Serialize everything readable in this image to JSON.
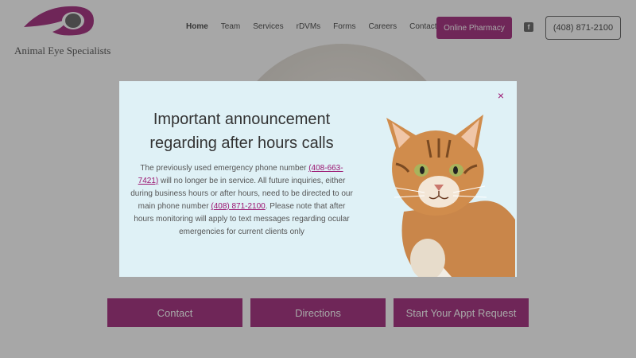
{
  "site": {
    "logo_text": "Animal Eye Specialists"
  },
  "nav": {
    "items": [
      {
        "label": "Home",
        "name": "nav-home"
      },
      {
        "label": "Team",
        "name": "nav-team"
      },
      {
        "label": "Services",
        "name": "nav-services"
      },
      {
        "label": "rDVMs",
        "name": "nav-rdvms"
      },
      {
        "label": "Forms",
        "name": "nav-forms"
      },
      {
        "label": "Careers",
        "name": "nav-careers"
      },
      {
        "label": "Contact",
        "name": "nav-contact"
      }
    ],
    "pharmacy_label": "Online Pharmacy",
    "facebook_icon": "facebook-icon",
    "phone_label": "(408) 871-2100"
  },
  "hero": {
    "buttons": [
      {
        "label": "Contact"
      },
      {
        "label": "Directions"
      },
      {
        "label": "Start Your Appt Request"
      }
    ]
  },
  "modal": {
    "close_symbol": "×",
    "title": "Important announcement regarding after hours calls",
    "body_part1": "The previously used emergency phone number ",
    "old_phone": "(408-663-7421)",
    "body_part2": " will no longer be in service. All future inquiries, either during business hours or after hours, need to be directed to our main phone number ",
    "main_phone": "(408) 871-2100",
    "body_part3": ". Please note that after hours monitoring will apply to text messages regarding ocular emergencies for current clients only",
    "image_icon": "cat-photo"
  },
  "colors": {
    "brand": "#9a1470",
    "modal_bg": "#dff1f6"
  }
}
